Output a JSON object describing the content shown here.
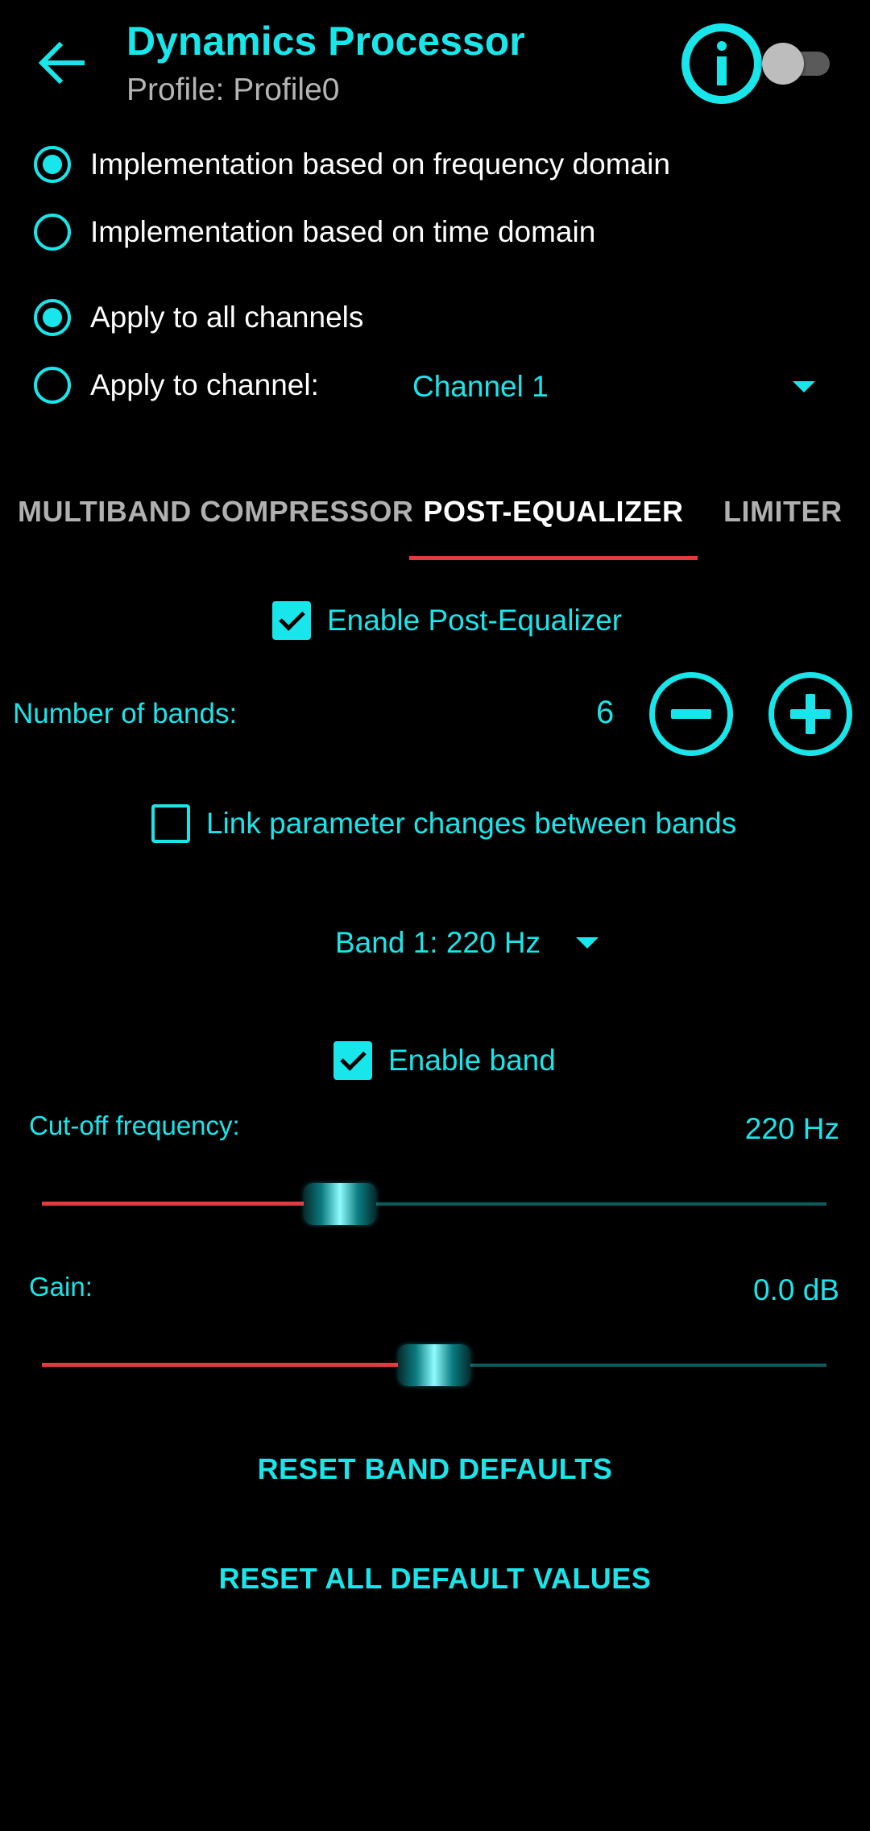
{
  "header": {
    "title": "Dynamics Processor",
    "subtitle": "Profile: Profile0",
    "toggle_on": false
  },
  "implementation": {
    "options": [
      {
        "label": "Implementation based on frequency domain",
        "checked": true
      },
      {
        "label": "Implementation based on time domain",
        "checked": false
      }
    ]
  },
  "channels": {
    "options": [
      {
        "label": "Apply to all channels",
        "checked": true
      },
      {
        "label": "Apply to channel:",
        "checked": false
      }
    ],
    "selected_channel": "Channel 1"
  },
  "tabs": [
    {
      "label": "MULTIBAND COMPRESSOR",
      "active": false
    },
    {
      "label": "POST-EQUALIZER",
      "active": true
    },
    {
      "label": "LIMITER",
      "active": false
    }
  ],
  "post_eq": {
    "enable_label": "Enable Post-Equalizer",
    "enabled": true,
    "bands_label": "Number of bands:",
    "bands_value": "6",
    "link_label": "Link parameter changes between bands",
    "link_checked": false,
    "band_select": "Band 1: 220 Hz",
    "enable_band_label": "Enable band",
    "enable_band_checked": true,
    "cutoff": {
      "label": "Cut-off frequency:",
      "value_text": "220 Hz",
      "position": 0.38
    },
    "gain": {
      "label": "Gain:",
      "value_text": "0.0 dB",
      "position": 0.5
    },
    "reset_band_label": "RESET BAND DEFAULTS",
    "reset_all_label": "RESET ALL DEFAULT VALUES"
  },
  "colors": {
    "accent": "#19e6ea",
    "indicator": "#e23b3b",
    "background": "#000000"
  },
  "icons": {
    "back": "arrow-left-icon",
    "info": "info-circle-icon",
    "dropdown": "triangle-down-icon",
    "minus": "minus-circle-icon",
    "plus": "plus-circle-icon"
  }
}
